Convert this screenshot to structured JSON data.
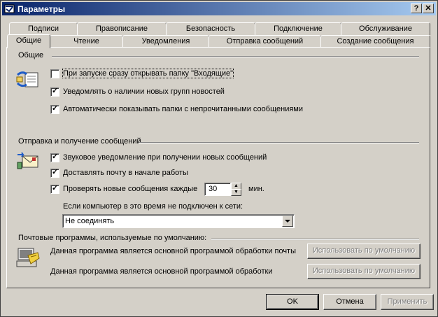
{
  "window": {
    "title": "Параметры",
    "help_btn": "?",
    "close_btn": "✕"
  },
  "tabs_row1": [
    "Подписи",
    "Правописание",
    "Безопасность",
    "Подключение",
    "Обслуживание"
  ],
  "tabs_row2": [
    "Общие",
    "Чтение",
    "Уведомления",
    "Отправка сообщений",
    "Создание сообщения"
  ],
  "active_tab": "Общие",
  "general": {
    "title": "Общие",
    "options": [
      {
        "label": "При запуске сразу открывать папку \"Входящие\"",
        "checked": false
      },
      {
        "label": "Уведомлять о наличии новых групп новостей",
        "checked": true
      },
      {
        "label": "Автоматически показывать папки с непрочитанными сообщениями",
        "checked": true
      }
    ]
  },
  "send_receive": {
    "title": "Отправка и получение сообщений",
    "options": [
      {
        "label": "Звуковое уведомление при получении новых сообщений",
        "checked": true
      },
      {
        "label": "Доставлять почту в начале работы",
        "checked": true
      },
      {
        "label": "Проверять новые сообщения каждые",
        "checked": true
      }
    ],
    "interval_value": "30",
    "interval_unit": "мин.",
    "offline_label": "Если компьютер в это время не подключен к сети:",
    "offline_value": "Не соединять"
  },
  "default_programs": {
    "title": "Почтовые программы, используемые по умолчанию:",
    "mail_text": "Данная программа является основной программой обработки почты",
    "news_text": "Данная программа является основной программой обработки",
    "set_default_label": "Использовать по умолчанию"
  },
  "buttons": {
    "ok": "OK",
    "cancel": "Отмена",
    "apply": "Применить"
  }
}
